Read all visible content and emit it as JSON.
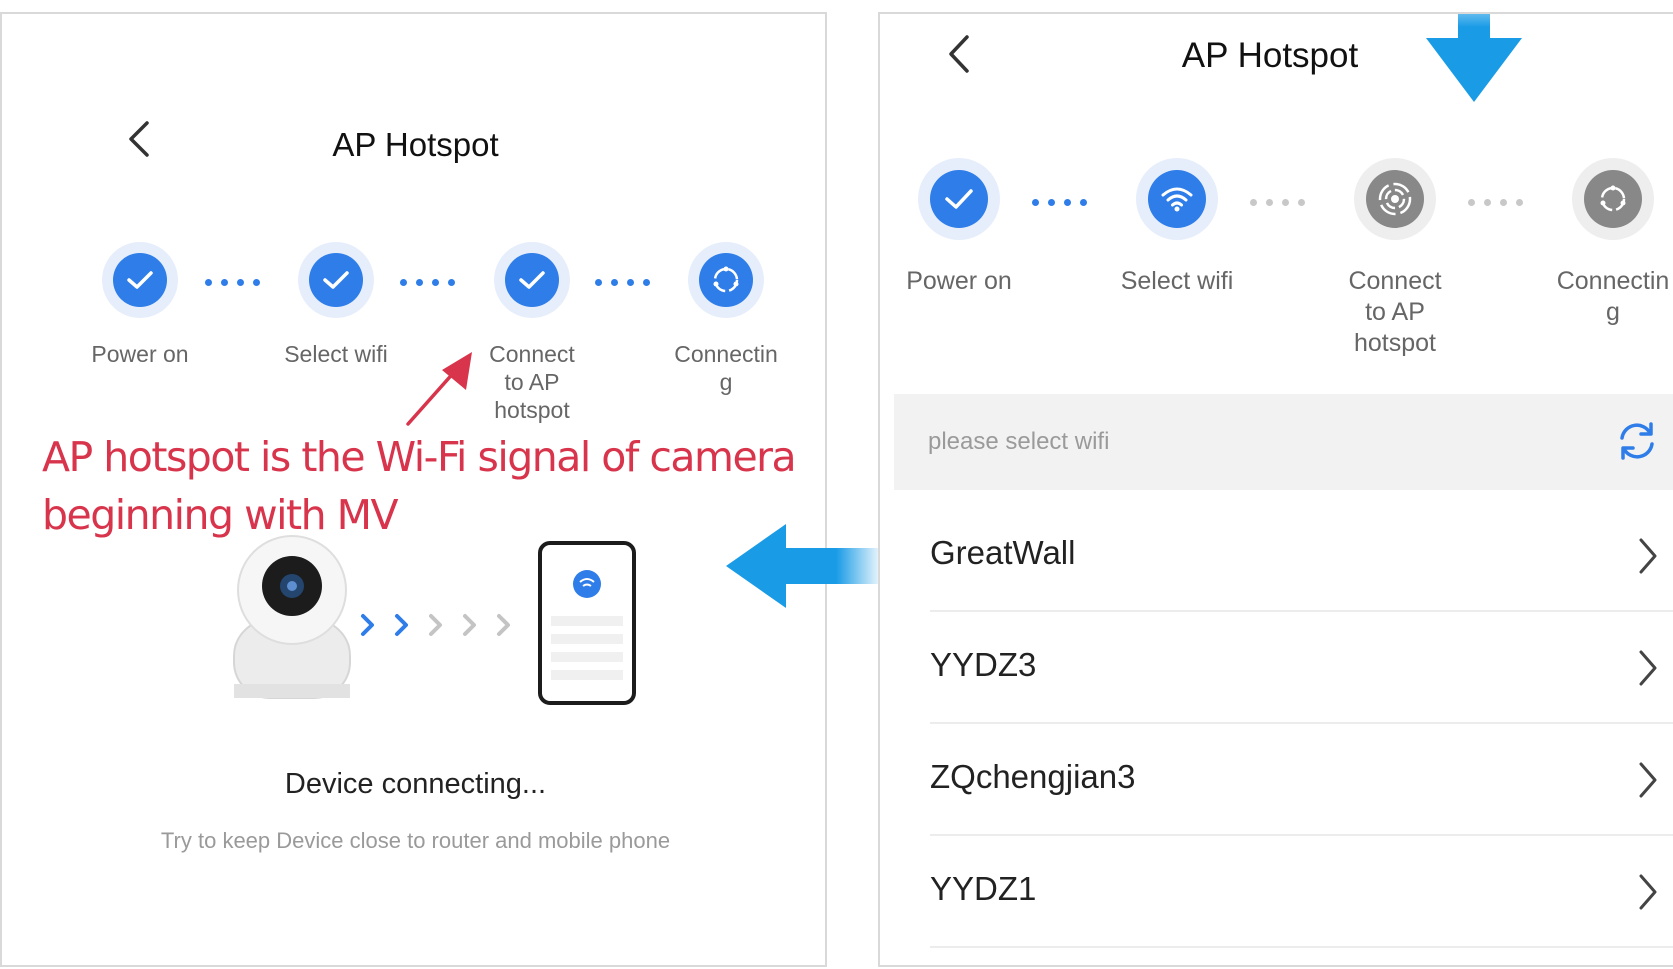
{
  "left_screen": {
    "title": "AP Hotspot",
    "steps": [
      "Power on",
      "Select wifi",
      "Connect\nto AP\nhotspot",
      "Connectin\ng"
    ],
    "annotation": {
      "line1": "AP hotspot is the Wi-Fi signal of camera",
      "line2": "beginning with MV",
      "color": "#d8344b"
    },
    "status_title": "Device connecting...",
    "status_hint": "Try to keep Device close to router and mobile phone"
  },
  "right_screen": {
    "title": "AP Hotspot",
    "steps": [
      "Power on",
      "Select wifi",
      "Connect\nto AP\nhotspot",
      "Connectin\ng"
    ],
    "wifi_placeholder": "please select wifi",
    "networks": [
      "GreatWall",
      "YYDZ3",
      "ZQchengjian3",
      "YYDZ1"
    ]
  },
  "colors": {
    "accent": "#2f7de8",
    "accent_halo": "#e6eefc",
    "inactive": "#888888",
    "inactive_halo": "#eeeeee",
    "arrow": "#1a9be6"
  }
}
